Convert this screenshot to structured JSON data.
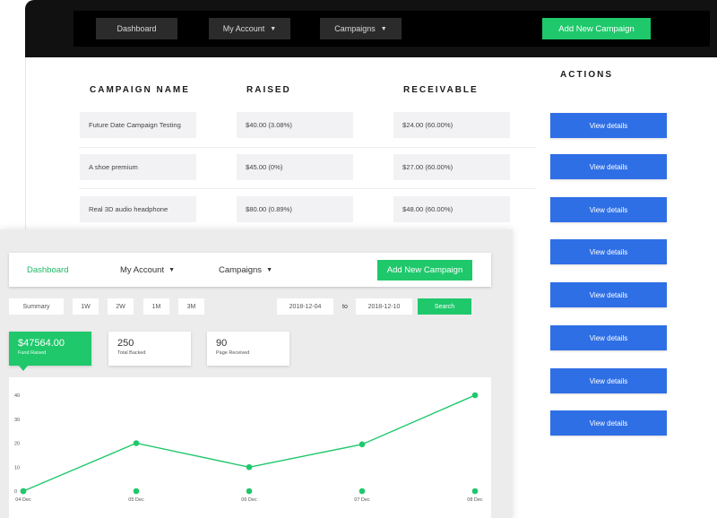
{
  "back_nav": {
    "dashboard": "Dashboard",
    "my_account": "My Account",
    "campaigns": "Campaigns",
    "add_new": "Add New Campaign"
  },
  "table": {
    "headers": {
      "campaign_name": "CAMPAIGN NAME",
      "raised": "RAISED",
      "receivable": "RECEIVABLE",
      "actions": "ACTIONS"
    },
    "rows": [
      {
        "name": "Future Date Campaign Testing",
        "raised": "$40.00 (3.08%)",
        "receivable": "$24.00 (60.00%)"
      },
      {
        "name": "A shoe premium",
        "raised": "$45.00 (0%)",
        "receivable": "$27.00 (60.00%)"
      },
      {
        "name": "Real 3D audio headphone",
        "raised": "$80.00 (0.89%)",
        "receivable": "$48.00 (60.00%)"
      }
    ],
    "action_label": "View details"
  },
  "front_nav": {
    "dashboard": "Dashboard",
    "my_account": "My Account",
    "campaigns": "Campaigns",
    "add_new": "Add New Campaign"
  },
  "filters": {
    "summary": "Summary",
    "w1": "1W",
    "w2": "2W",
    "m1": "1M",
    "m3": "3M",
    "date_from": "2018-12-04",
    "to": "to",
    "date_to": "2018-12-10",
    "search": "Search"
  },
  "stats": [
    {
      "value": "$47564.00",
      "label": "Fund Raised"
    },
    {
      "value": "250",
      "label": "Total Backed"
    },
    {
      "value": "90",
      "label": "Page Received"
    }
  ],
  "colors": {
    "green": "#1fc86b",
    "blue": "#2f6fe6",
    "dark": "#111111"
  },
  "chart_data": {
    "type": "line",
    "x": [
      "04 Dec",
      "05 Dec",
      "06 Dec",
      "07 Dec",
      "08 Dec"
    ],
    "series": [
      {
        "values": [
          0,
          20,
          10,
          19.5,
          40
        ]
      }
    ],
    "y_ticks": [
      0,
      10,
      20,
      30,
      40
    ],
    "ylim": [
      0,
      40
    ],
    "grid": false,
    "title": "",
    "xlabel": "",
    "ylabel": ""
  }
}
